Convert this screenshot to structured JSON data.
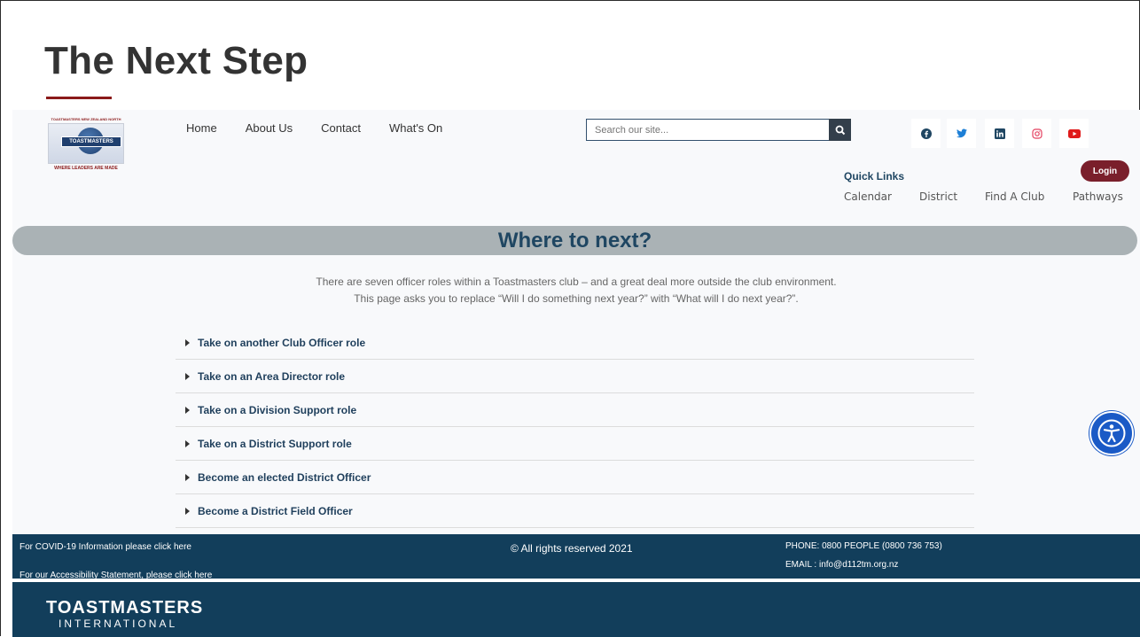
{
  "slide": {
    "title": "The Next Step"
  },
  "header": {
    "logo": {
      "top_text": "TOASTMASTERS NEW ZEALAND NORTH",
      "brand": "TOASTMASTERS",
      "tagline": "WHERE LEADERS ARE MADE"
    },
    "nav": [
      "Home",
      "About Us",
      "Contact",
      "What's On"
    ],
    "search": {
      "placeholder": "Search our site..."
    },
    "social": [
      "facebook-icon",
      "twitter-icon",
      "linkedin-icon",
      "instagram-icon",
      "youtube-icon"
    ],
    "login_label": "Login",
    "quick_links": {
      "title": "Quick Links",
      "items": [
        "Calendar",
        "District",
        "Find A Club",
        "Pathways"
      ]
    }
  },
  "main": {
    "heading": "Where to next?",
    "intro_line1": "There are seven officer roles within a Toastmasters club – and a great deal more outside the club environment.",
    "intro_line2": "This page asks you to replace “Will I do something next year?” with “What will I do next year?”.",
    "accordion": [
      "Take on another Club Officer role",
      "Take on an Area Director role",
      "Take on a Division Support role",
      "Take on a District Support role",
      "Become an elected District Officer",
      "Become a District Field Officer"
    ]
  },
  "footer": {
    "covid": "For COVID-19 Information please click here",
    "accessibility": "For our Accessibility Statement, please click here",
    "copyright": "© All rights reserved 2021",
    "phone": "PHONE: 0800 PEOPLE (0800 736 753)",
    "email": "EMAIL : info@d112tm.org.nz"
  },
  "brand_footer": {
    "name": "TOASTMASTERS",
    "sub": "INTERNATIONAL"
  },
  "colors": {
    "accent": "#7a1f2b",
    "navy": "#123e5b",
    "heading": "#1f4662",
    "banner": "#aab2b5"
  }
}
